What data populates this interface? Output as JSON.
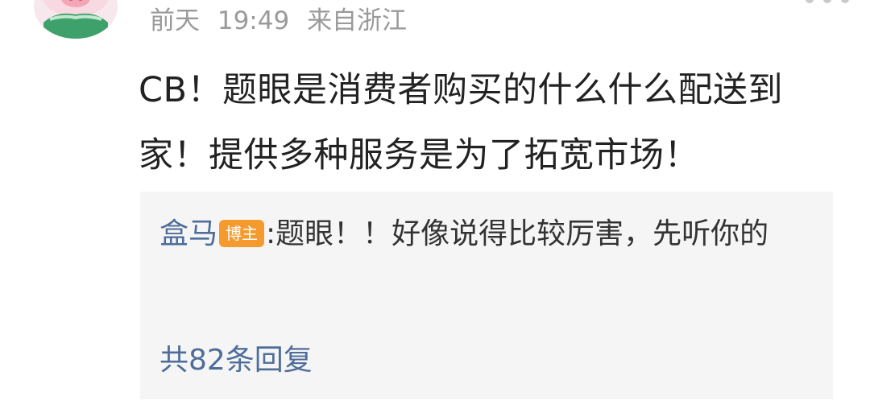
{
  "comment": {
    "meta": {
      "date": "前天",
      "time": "19:49",
      "location": "来自浙江"
    },
    "text": "CB！题眼是消费者购买的什么什么配送到家！提供多种服务是为了拓宽市场！",
    "avatar_icon": "avatar-icon",
    "more_icon": "more-icon"
  },
  "reply_preview": {
    "author": "盒马",
    "badge": "博主",
    "separator": ":",
    "text": "题眼！！好像说得比较厉害，先听你的",
    "count": "共82条回复"
  },
  "colors": {
    "background": "#ffffff",
    "meta_text": "#9a9a9a",
    "body_text": "#222222",
    "reply_background": "#f5f5f5",
    "link_blue": "#4e6d9b",
    "badge_orange": "#f59a2f"
  }
}
